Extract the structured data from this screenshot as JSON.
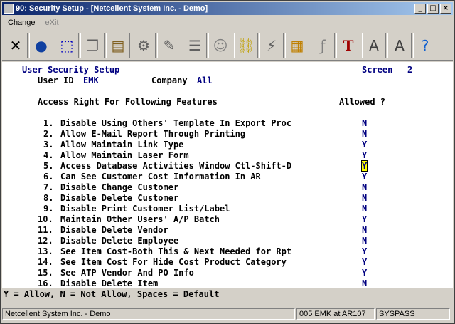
{
  "window": {
    "title": "90: Security Setup - [Netcellent System Inc. - Demo]",
    "minimize": "_",
    "maximize": "□",
    "close": "×"
  },
  "menu": {
    "items": [
      "Change",
      "eXit"
    ]
  },
  "toolbar": {
    "icons": [
      "close-x-icon",
      "globe-icon",
      "select-rect-icon",
      "copy-icon",
      "paste-icon",
      "gear-icon",
      "edit-icon",
      "list-icon",
      "people-icon",
      "link-icon",
      "lightning-icon",
      "calendar-icon",
      "script-icon",
      "font-tt-icon",
      "font-increase-icon",
      "font-decrease-icon",
      "help-icon"
    ]
  },
  "screen": {
    "header_title": "User Security Setup",
    "screen_label": "Screen",
    "screen_number": "2",
    "user_label": "User ID",
    "user_value": "EMK",
    "company_label": "Company",
    "company_value": "All",
    "access_heading": "Access Right For Following Features",
    "allowed_heading": "Allowed ?",
    "features": [
      {
        "no": "1.",
        "label": "Disable Using Others' Template In Export Proc",
        "value": "N"
      },
      {
        "no": "2.",
        "label": "Allow E-Mail Report Through Printing",
        "value": "N"
      },
      {
        "no": "3.",
        "label": "Allow Maintain Link Type",
        "value": "Y"
      },
      {
        "no": "4.",
        "label": "Allow Maintain Laser Form",
        "value": "Y"
      },
      {
        "no": "5.",
        "label": "Access Database Activities Window Ctl-Shift-D",
        "value": "Y"
      },
      {
        "no": "6.",
        "label": "Can See Customer Cost Information In AR",
        "value": "Y"
      },
      {
        "no": "7.",
        "label": "Disable Change Customer",
        "value": "N"
      },
      {
        "no": "8.",
        "label": "Disable Delete Customer",
        "value": "N"
      },
      {
        "no": "9.",
        "label": "Disable Print Customer List/Label",
        "value": "N"
      },
      {
        "no": "10.",
        "label": "Maintain Other Users' A/P Batch",
        "value": "Y"
      },
      {
        "no": "11.",
        "label": "Disable Delete Vendor",
        "value": "N"
      },
      {
        "no": "12.",
        "label": "Disable Delete Employee",
        "value": "N"
      },
      {
        "no": "13.",
        "label": "See Item Cost-Both This & Next Needed for Rpt",
        "value": "Y"
      },
      {
        "no": "14.",
        "label": "See Item Cost For Hide Cost Product Category",
        "value": "Y"
      },
      {
        "no": "15.",
        "label": "See ATP Vendor And PO Info",
        "value": "Y"
      },
      {
        "no": "16.",
        "label": "Disable Delete Item",
        "value": "N"
      }
    ]
  },
  "help_line": "Y = Allow, N = Not Allow, Spaces = Default",
  "status": {
    "company": "Netcellent System Inc. - Demo",
    "session": "005 EMK at AR107",
    "mode": "SYSPASS"
  }
}
